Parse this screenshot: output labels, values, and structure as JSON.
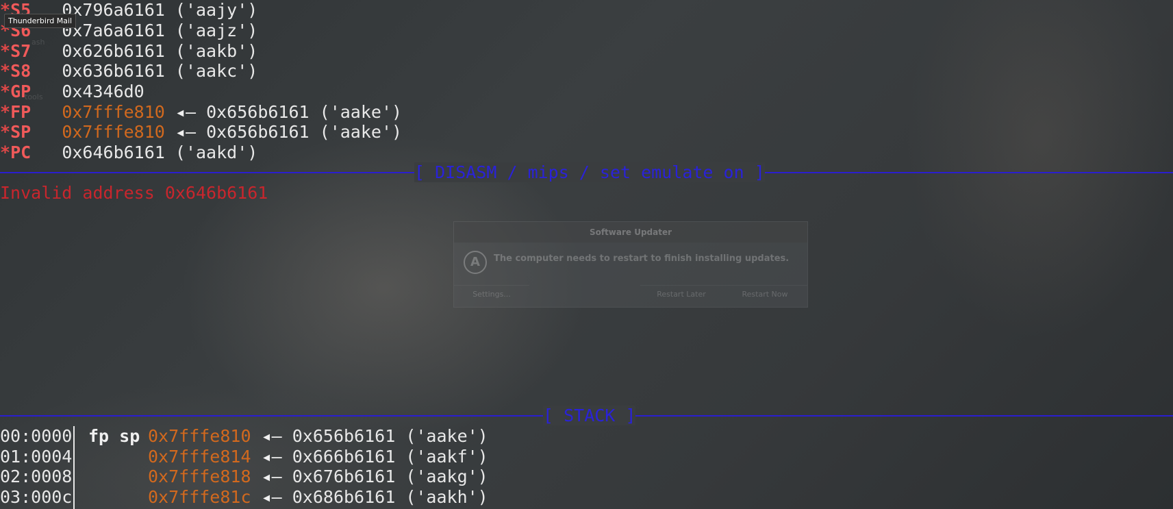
{
  "tooltip": {
    "text": "Thunderbird Mail"
  },
  "launcher_ghost": {
    "item1": "ash",
    "item2": "tools"
  },
  "dialog": {
    "title": "Software Updater",
    "icon": "software-updater-icon",
    "message": "The computer needs to restart to finish installing updates.",
    "settings_label": "Settings...",
    "later_label": "Restart Later",
    "now_label": "Restart Now"
  },
  "registers": [
    {
      "star": "*",
      "name": "S5",
      "value": "0x796a6161 ('aajy')"
    },
    {
      "star": "*",
      "name": "S6",
      "value": "0x7a6a6161 ('aajz')"
    },
    {
      "star": "*",
      "name": "S7",
      "value": "0x626b6161 ('aakb')"
    },
    {
      "star": "*",
      "name": "S8",
      "value": "0x636b6161 ('aakc')"
    },
    {
      "star": "*",
      "name": "GP",
      "value": "0x4346d0"
    },
    {
      "star": "*",
      "name": "FP",
      "addr": "0x7fffe810",
      "arrow": "◂—",
      "value": "0x656b6161 ('aake')"
    },
    {
      "star": "*",
      "name": "SP",
      "addr": "0x7fffe810",
      "arrow": "◂—",
      "value": "0x656b6161 ('aake')"
    },
    {
      "star": "*",
      "name": "PC",
      "value": "0x646b6161 ('aakd')"
    }
  ],
  "disasm": {
    "header": "[ DISASM / mips / set emulate on ]",
    "error": "Invalid address 0x646b6161"
  },
  "stack": {
    "header": "[ STACK ]",
    "rows": [
      {
        "offset": "00:0000",
        "label": "fp sp",
        "addr": "0x7fffe810",
        "arrow": "◂—",
        "value": "0x656b6161 ('aake')"
      },
      {
        "offset": "01:0004",
        "label": "",
        "addr": "0x7fffe814",
        "arrow": "◂—",
        "value": "0x666b6161 ('aakf')"
      },
      {
        "offset": "02:0008",
        "label": "",
        "addr": "0x7fffe818",
        "arrow": "◂—",
        "value": "0x676b6161 ('aakg')"
      },
      {
        "offset": "03:000c",
        "label": "",
        "addr": "0x7fffe81c",
        "arrow": "◂—",
        "value": "0x686b6161 ('aakh')"
      }
    ]
  },
  "colors": {
    "register_name": "#f05a5a",
    "stack_address": "#d2691e",
    "section_rule": "#2a1ed0",
    "error_text": "#c8262d"
  }
}
